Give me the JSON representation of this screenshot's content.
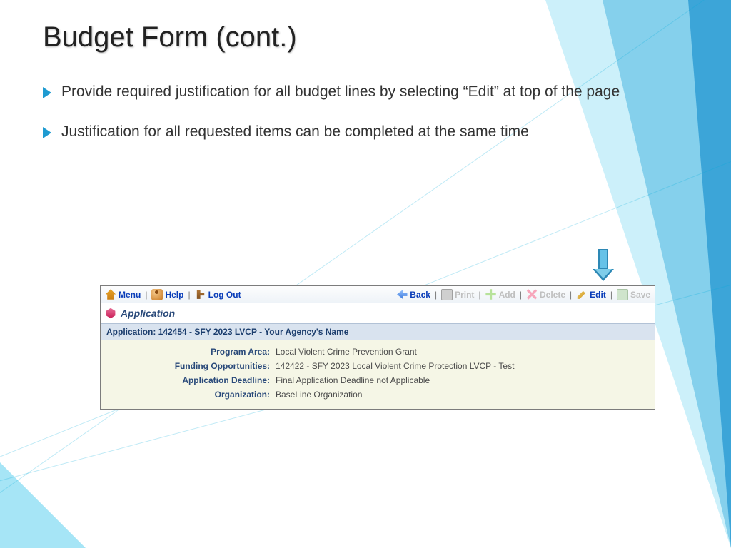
{
  "slide": {
    "title": "Budget Form (cont.)",
    "bullets": [
      "Provide required justification for all budget lines by selecting “Edit” at top of the page",
      "Justification for all requested items can be completed at the same time"
    ]
  },
  "toolbar": {
    "menu": "Menu",
    "help": "Help",
    "logout": "Log Out",
    "back": "Back",
    "print": "Print",
    "add": "Add",
    "delete": "Delete",
    "edit": "Edit",
    "save": "Save",
    "separator": "|"
  },
  "app": {
    "section_title": "Application",
    "header": "Application: 142454 - SFY 2023 LVCP - Your Agency's Name",
    "fields": {
      "program_area": {
        "label": "Program Area:",
        "value": "Local Violent Crime Prevention Grant"
      },
      "funding": {
        "label": "Funding Opportunities:",
        "value": "142422 - SFY 2023 Local Violent Crime Protection LVCP - Test"
      },
      "deadline": {
        "label": "Application Deadline:",
        "value": "Final Application Deadline not Applicable"
      },
      "org": {
        "label": "Organization:",
        "value": "BaseLine Organization"
      }
    }
  }
}
